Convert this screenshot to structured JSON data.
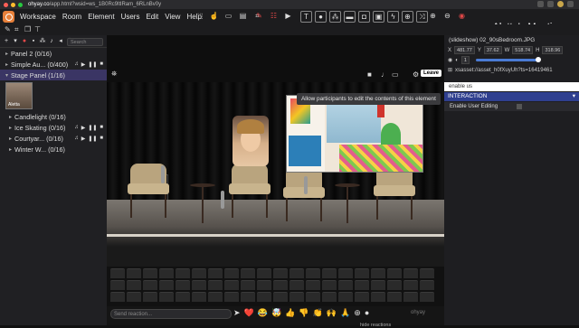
{
  "browser": {
    "url_host": "ohyay.co",
    "url_path": "/app.html?wsid=ws_1B0Rc9ltlRam_6RLnBv0y"
  },
  "menu": {
    "items": [
      "Workspace",
      "Room",
      "Element",
      "Users",
      "Edit",
      "View",
      "Help"
    ]
  },
  "app_title": "Aletta's Meetings",
  "left_panel": {
    "search_placeholder": "Search",
    "items": [
      {
        "label": "Panel 2 (0/16)"
      },
      {
        "label": "Simple Au... (0/400)"
      },
      {
        "label": "Stage Panel (1/16)"
      }
    ],
    "thumb_label": "Aletta",
    "sub_items": [
      {
        "label": "Candlelight (0/16)"
      },
      {
        "label": "Ice Skating (0/16)"
      },
      {
        "label": "Courtyar... (0/16)"
      },
      {
        "label": "Winter W... (0/16)"
      }
    ]
  },
  "stage": {
    "leave_label": "Leave",
    "tooltip": "Allow participants to edit the contents of this element",
    "reaction_placeholder": "Send reaction...",
    "hide_reactions": "hide reactions",
    "brand": "ohyay",
    "emojis": [
      "➤",
      "❤️",
      "😂",
      "🤯",
      "👍",
      "👎",
      "👏",
      "🙌",
      "🙏",
      "⊕",
      "●"
    ]
  },
  "right_panel": {
    "element_name": "(slideshow) 02_90sBedroom.JPG",
    "x_label": "X",
    "x_value": "481.77",
    "y_label": "Y",
    "y_value": "37.62",
    "w_label": "W",
    "w_value": "518.74",
    "h_label": "H",
    "h_value": "318.96",
    "url_value": "xsasset://asset_h0fXuyUh?ts=16419461",
    "search_value": "enable us",
    "section": "INTERACTION",
    "property": "Enable User Editing"
  }
}
